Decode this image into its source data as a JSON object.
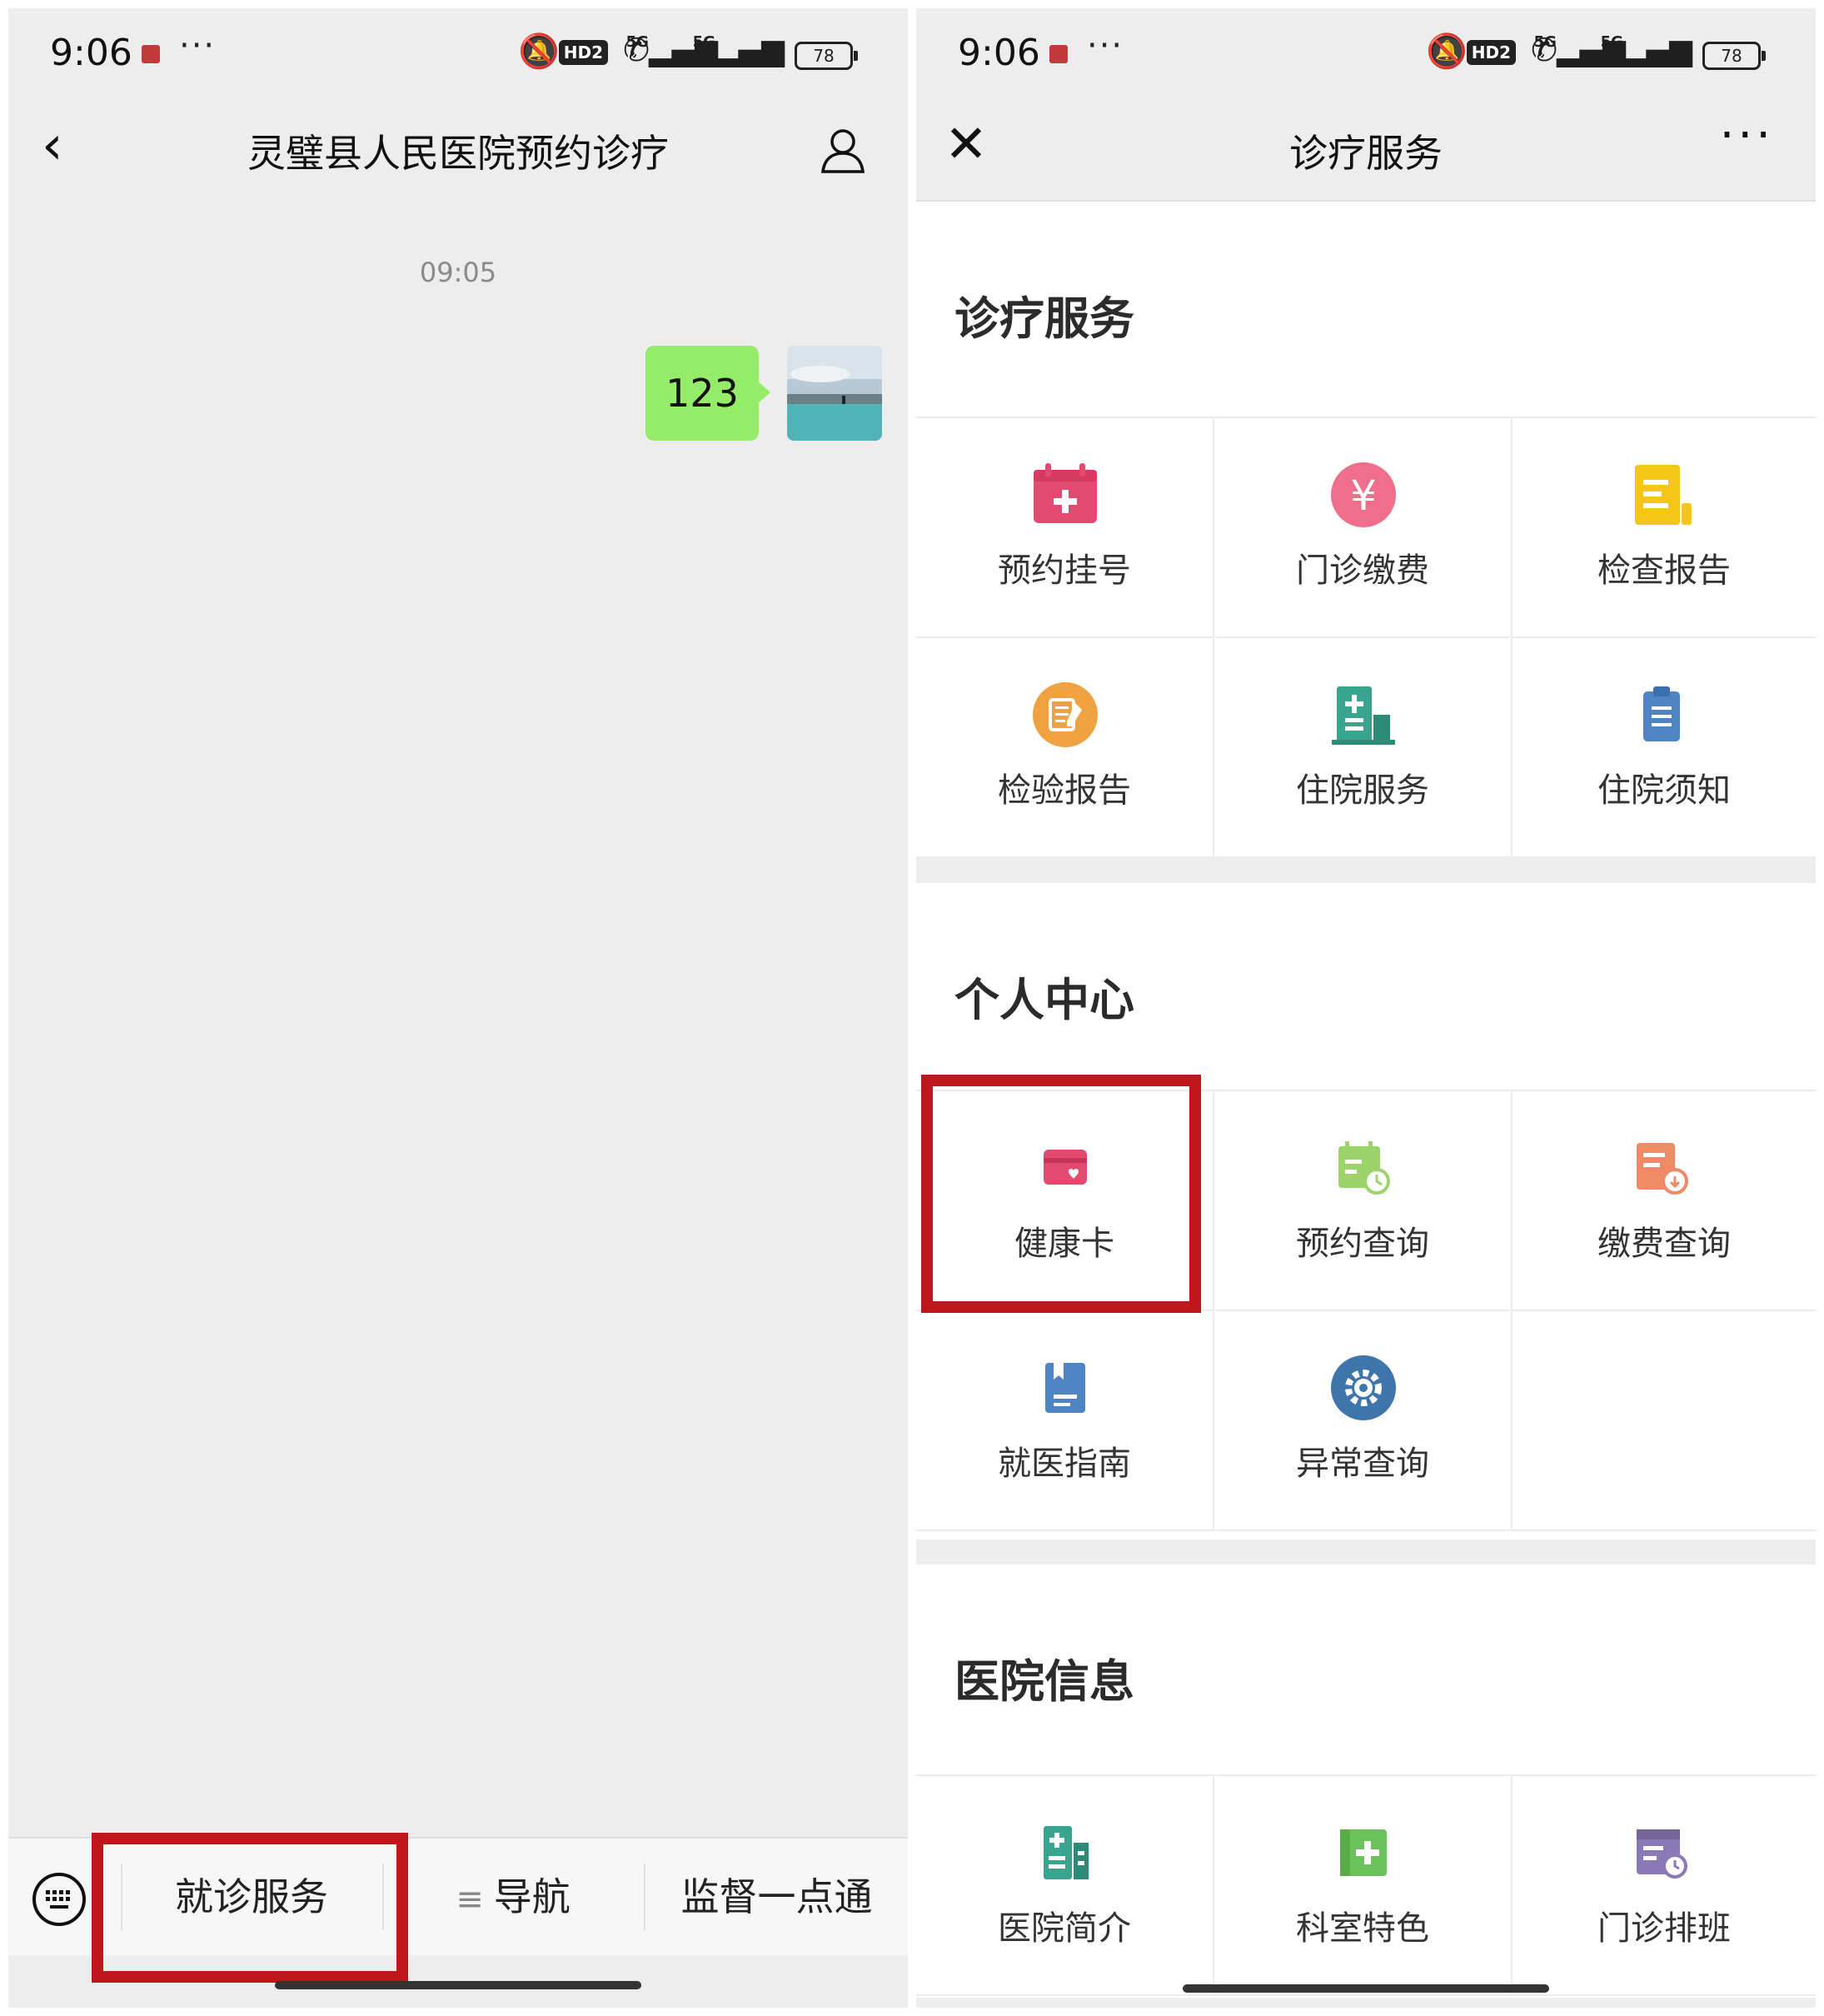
{
  "status_bar": {
    "time": "9:06",
    "dots": "···",
    "hd_label": "HD2",
    "net1": "5G",
    "net2": "5G",
    "battery": "78"
  },
  "left": {
    "title": "灵璧县人民医院预约诊疗",
    "timestamp": "09:05",
    "message": "123",
    "menu": {
      "item1": "就诊服务",
      "item2": "导航",
      "item3": "监督一点通"
    }
  },
  "right": {
    "title": "诊疗服务",
    "sections": {
      "clinical": {
        "title": "诊疗服务",
        "items": [
          "预约挂号",
          "门诊缴费",
          "检查报告",
          "检验报告",
          "住院服务",
          "住院须知"
        ]
      },
      "personal": {
        "title": "个人中心",
        "items": [
          "健康卡",
          "预约查询",
          "缴费查询",
          "就医指南",
          "异常查询"
        ]
      },
      "hospital": {
        "title": "医院信息",
        "items": [
          "医院简介",
          "科室特色",
          "门诊排班"
        ]
      }
    }
  },
  "colors": {
    "highlight": "#c0161b",
    "bubble": "#95ec69",
    "appointment_icon": "#e34a6f",
    "payment_icon": "#ef6f8b",
    "report_icon": "#f5c518",
    "lab_icon": "#f0a243",
    "inpatient_icon": "#3aa58f",
    "notice_icon": "#4f84c4"
  },
  "icons": [
    "back-arrow-icon",
    "profile-icon",
    "close-icon",
    "more-icon",
    "keyboard-icon",
    "menu-lines-icon"
  ]
}
